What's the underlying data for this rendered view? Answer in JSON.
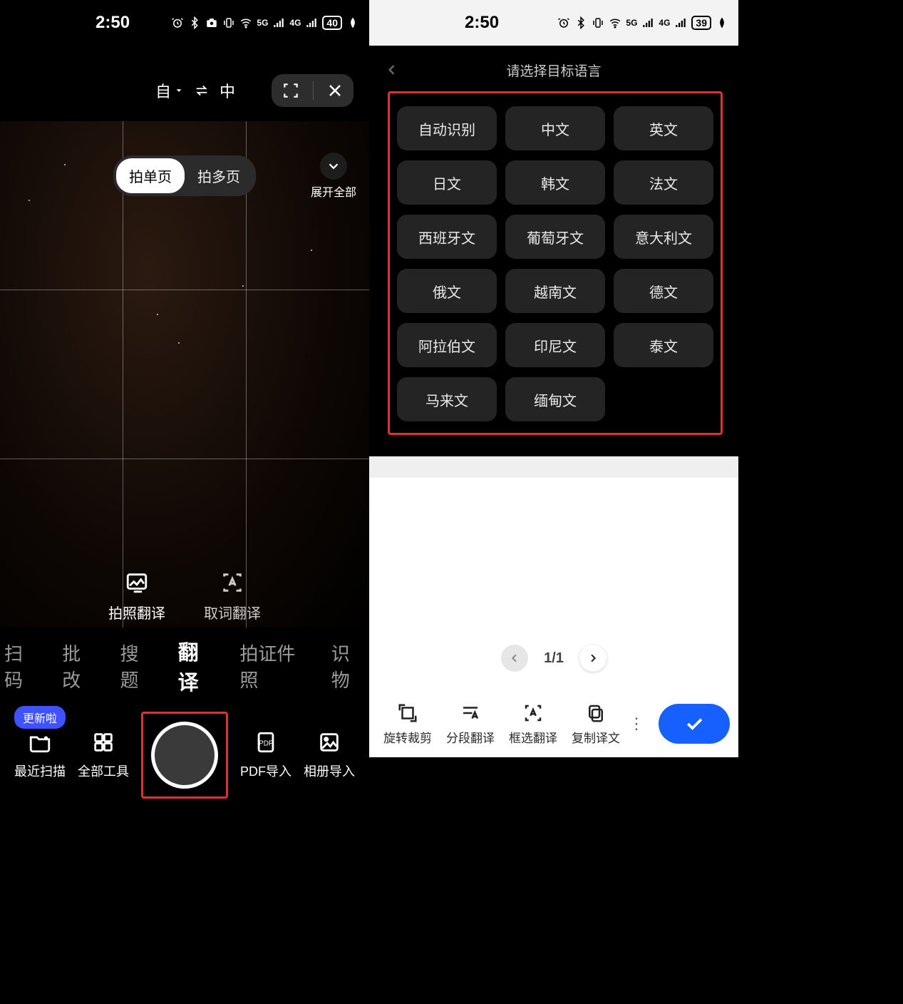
{
  "left": {
    "status": {
      "time": "2:50",
      "battery": "40",
      "sig1": "5G",
      "sig2": "4G"
    },
    "lang_from": "自",
    "lang_to": "中",
    "page_single": "拍单页",
    "page_multi": "拍多页",
    "expand_all": "展开全部",
    "mode_photo": "拍照翻译",
    "mode_word": "取词翻译",
    "cats": {
      "scan": "扫码",
      "mark": "批改",
      "search": "搜题",
      "trans": "翻译",
      "id": "拍证件照",
      "obj": "识物"
    },
    "badge": "更新啦",
    "recent": "最近扫描",
    "alltools": "全部工具",
    "pdf": "PDF导入",
    "album": "相册导入"
  },
  "right": {
    "status": {
      "time": "2:50",
      "battery": "39",
      "sig1": "5G",
      "sig2": "4G"
    },
    "header": "请选择目标语言",
    "langs": [
      "自动识别",
      "中文",
      "英文",
      "日文",
      "韩文",
      "法文",
      "西班牙文",
      "葡萄牙文",
      "意大利文",
      "俄文",
      "越南文",
      "德文",
      "阿拉伯文",
      "印尼文",
      "泰文",
      "马来文",
      "缅甸文"
    ],
    "page_indicator": "1/1",
    "tool_rotate": "旋转裁剪",
    "tool_segment": "分段翻译",
    "tool_select": "框选翻译",
    "tool_copy": "复制译文"
  }
}
